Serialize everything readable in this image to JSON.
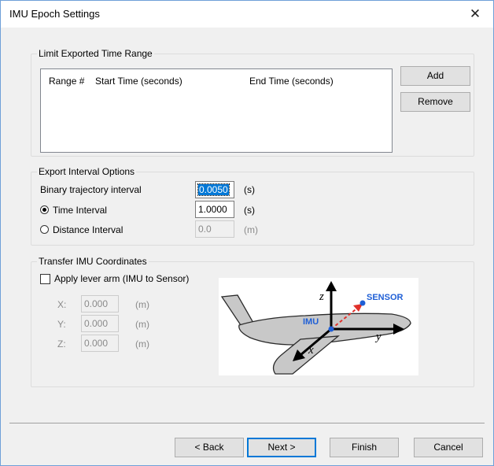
{
  "window": {
    "title": "IMU Epoch Settings",
    "close_glyph": "✕"
  },
  "limit_group": {
    "title": "Limit Exported Time Range",
    "columns": [
      "Range #",
      "Start Time (seconds)",
      "End Time (seconds)"
    ],
    "add_label": "Add",
    "remove_label": "Remove"
  },
  "export_group": {
    "title": "Export Interval Options",
    "binary_label": "Binary trajectory interval",
    "binary_value": "0.0050",
    "binary_unit": "(s)",
    "time_label": "Time Interval",
    "time_value": "1.0000",
    "time_unit": "(s)",
    "time_selected": true,
    "distance_label": "Distance Interval",
    "distance_value": "0.0",
    "distance_unit": "(m)"
  },
  "transfer_group": {
    "title": "Transfer IMU Coordinates",
    "apply_label": "Apply lever arm (IMU to Sensor)",
    "apply_checked": false,
    "x_label": "X:",
    "x_value": "0.000",
    "y_label": "Y:",
    "y_value": "0.000",
    "z_label": "Z:",
    "z_value": "0.000",
    "unit": "(m)",
    "diagram": {
      "z_axis": "z",
      "y_axis": "y",
      "x_axis": "x",
      "imu": "IMU",
      "sensor": "SENSOR"
    }
  },
  "footer": {
    "back_label": "< Back",
    "next_label": "Next >",
    "finish_label": "Finish",
    "cancel_label": "Cancel"
  },
  "colors": {
    "accent": "#0078d7",
    "diagram_blue": "#1f5fd6",
    "diagram_red": "#e0302a"
  }
}
